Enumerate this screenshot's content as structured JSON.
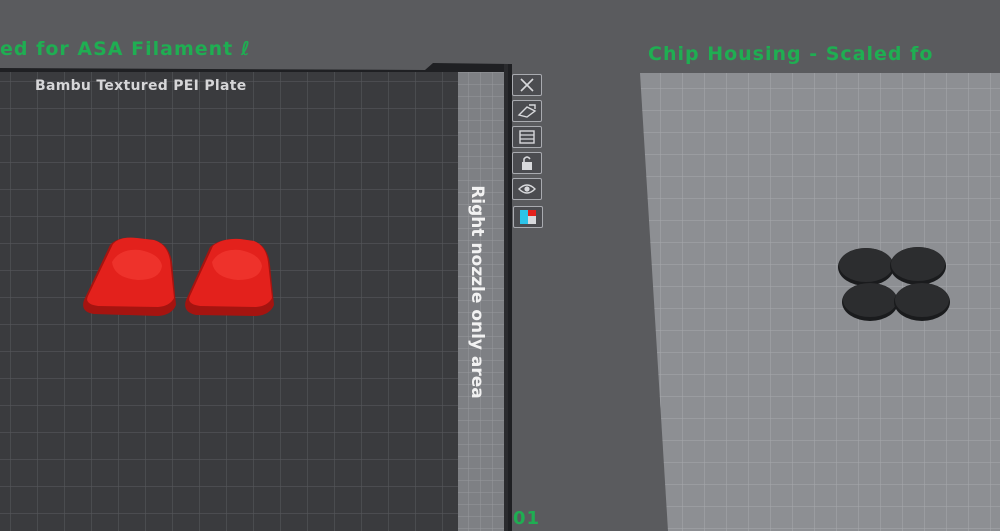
{
  "plates": {
    "left": {
      "title": "ed for ASA Filament",
      "plate_type_label": "Bambu Textured PEI Plate",
      "nozzle_area_label": "Right nozzle only area",
      "plate_number": "01",
      "object_color": "#e3211c"
    },
    "right": {
      "title": "Chip Housing - Scaled fo",
      "object_color": "#2c2d2f"
    }
  },
  "plate_toolbar": [
    {
      "name": "close-plate-button",
      "icon": "close-icon"
    },
    {
      "name": "auto-arrange-button",
      "icon": "arrange-icon"
    },
    {
      "name": "plate-settings-button",
      "icon": "settings-icon"
    },
    {
      "name": "lock-plate-button",
      "icon": "lock-icon"
    },
    {
      "name": "preview-plate-button",
      "icon": "eye-icon"
    },
    {
      "name": "plate-color-button",
      "icon": "color-icon"
    }
  ],
  "colors": {
    "title_green": "#1fae52",
    "background": "#5a5b5e",
    "left_plate": "#3a3b3e",
    "right_plate": "#8d8f93"
  }
}
